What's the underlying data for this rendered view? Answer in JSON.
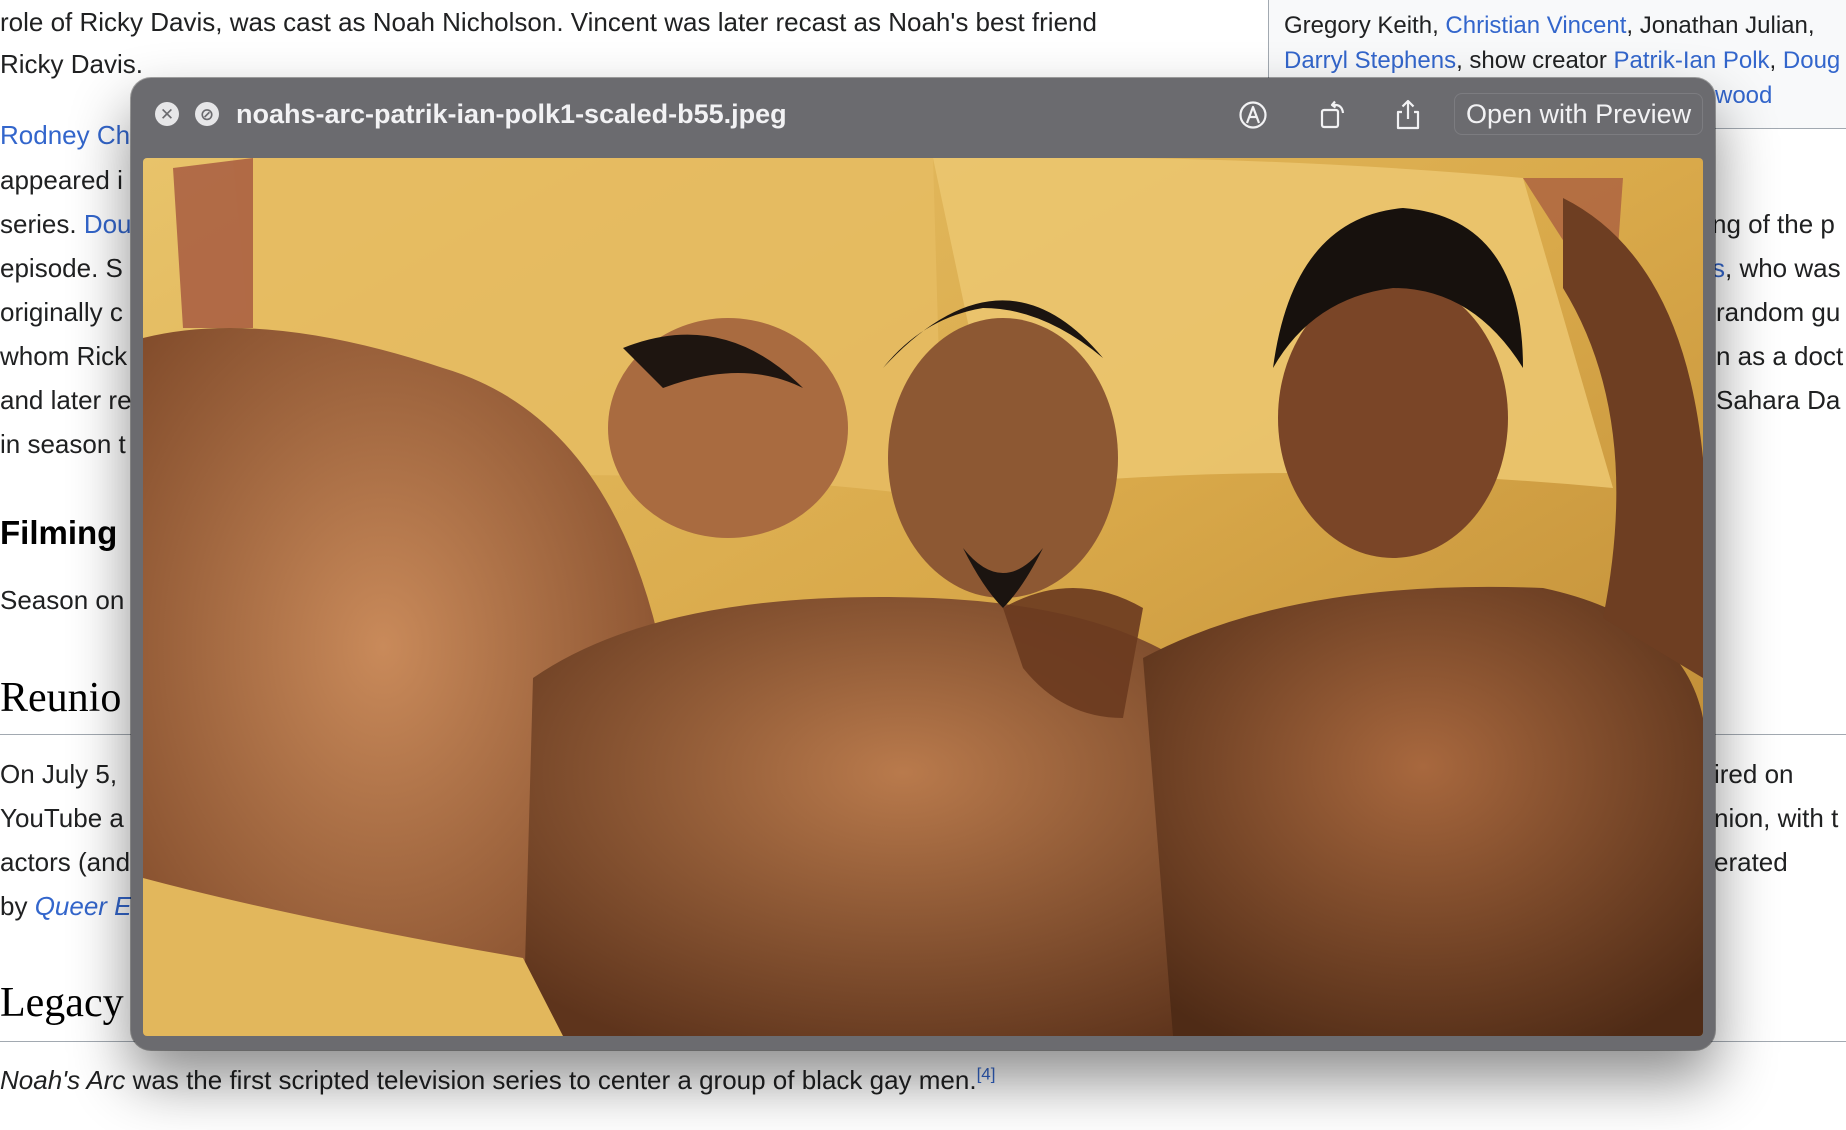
{
  "article": {
    "line1": "role of Ricky Davis, was cast as Noah Nicholson. Vincent was later recast as Noah's best friend",
    "line2": "Ricky Davis.",
    "cast_paragraph": {
      "line1_link": "Rodney Ch",
      "line2": "appeared i",
      "line3_text": "series. ",
      "line3_link": "Dou",
      "line4": "episode. S",
      "line5": "originally c",
      "line6": "whom Rick",
      "line7": "and later re",
      "line8": "in season t"
    },
    "cast_paragraph_right": {
      "line3": "ng of the p",
      "line4_link": "s",
      "line4_text": ", who was",
      "line5": "random gu",
      "line6": "n as a doct",
      "line7": "Sahara Da"
    },
    "filming": {
      "heading": "Filming",
      "text": "Season on"
    },
    "reunion": {
      "heading": "Reunio",
      "line1": "On July 5,",
      "line2": "YouTube a",
      "line3": "actors (and",
      "line4_text": "by ",
      "line4_link": "Queer E",
      "right_line1": "ired on",
      "right_line2": "nion, with t",
      "right_line3": "erated"
    },
    "legacy": {
      "heading": "Legacy",
      "sentence_title": "Noah's Arc",
      "sentence_rest": " was the first scripted television series to center a group of black gay men.",
      "citation": "[4]"
    }
  },
  "infobox": {
    "line1_text_a": "Gregory Keith, ",
    "line1_link": "Christian Vincent",
    "line1_text_b": ", Jonathan Julian,",
    "line2_link_a": "Darryl Stephens",
    "line2_text": ", show creator ",
    "line2_link_b": "Patrik-Ian Polk",
    "line2_text_b": ", ",
    "line2_link_c": "Doug",
    "line3_link": "wood"
  },
  "quicklook": {
    "filename": "noahs-arc-patrik-ian-polk1-scaled-b55.jpeg",
    "close_icon": "close-icon",
    "fullscreen_icon": "fullscreen-icon",
    "markup_icon": "markup-icon",
    "rotate_icon": "rotate-icon",
    "share_icon": "share-icon",
    "open_button": "Open with Preview"
  },
  "colors": {
    "link": "#3366cc",
    "window_chrome": "#6b6b6f",
    "page_bg": "#ffffff"
  }
}
